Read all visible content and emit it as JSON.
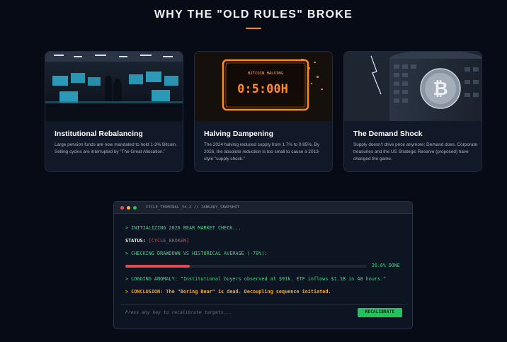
{
  "page": {
    "title": "WHY THE \"OLD RULES\" BROKE"
  },
  "colors": {
    "accent_orange": "#f08a2c",
    "card_bg": "#111827",
    "terminal_green": "#3ddc7d",
    "terminal_red": "#e0484b",
    "button_green": "#22c35e"
  },
  "cards": [
    {
      "title": "Institutional Rebalancing",
      "body": "Large pension funds are now mandated to hold 1-3% Bitcoin. Selling cycles are interrupted by \"The Great Allocation.\"",
      "image": "trading-floor-image"
    },
    {
      "title": "Halving Dampening",
      "body": "The 2024 halving reduced supply from 1.7% to 0.85%. By 2026, the absolute reduction is too small to cause a 2013-style \"supply shock.\"",
      "image": "halving-countdown-image",
      "image_text_top": "BITCOIN HALVING",
      "image_text_counter": "0:5:00H"
    },
    {
      "title": "The Demand Shock",
      "body": "Supply doesn't drive price anymore; Demand does. Corporate treasuries and the US Strategic Reserve (proposed) have changed the game.",
      "image": "bitcoin-vault-image"
    }
  ],
  "terminal": {
    "window_title": "CYCLE_TERMINAL_V4.2 // JANUARY_SNAPSHOT",
    "line1": "> INITIALIZING 2026 BEAR MARKET CHECK...",
    "status_label": "STATUS:",
    "status_value": "[CYCLE_BROKEN]",
    "line3": "> CHECKING DRAWDOWN VS HISTORICAL AVERAGE (-78%):",
    "progress_percent": 26.6,
    "progress_label": "26.6% DONE",
    "line4": "> LOGGING ANOMALY: \"Institutional buyers observed at $91k. ETF inflows $1.1B in 48 hours.\"",
    "line5": "> CONCLUSION: The \"Boring Bear\" is dead. Decoupling sequence initiated.",
    "prompt": "Press any key to recalibrate targets...",
    "button_label": "RECALIBRATE"
  }
}
